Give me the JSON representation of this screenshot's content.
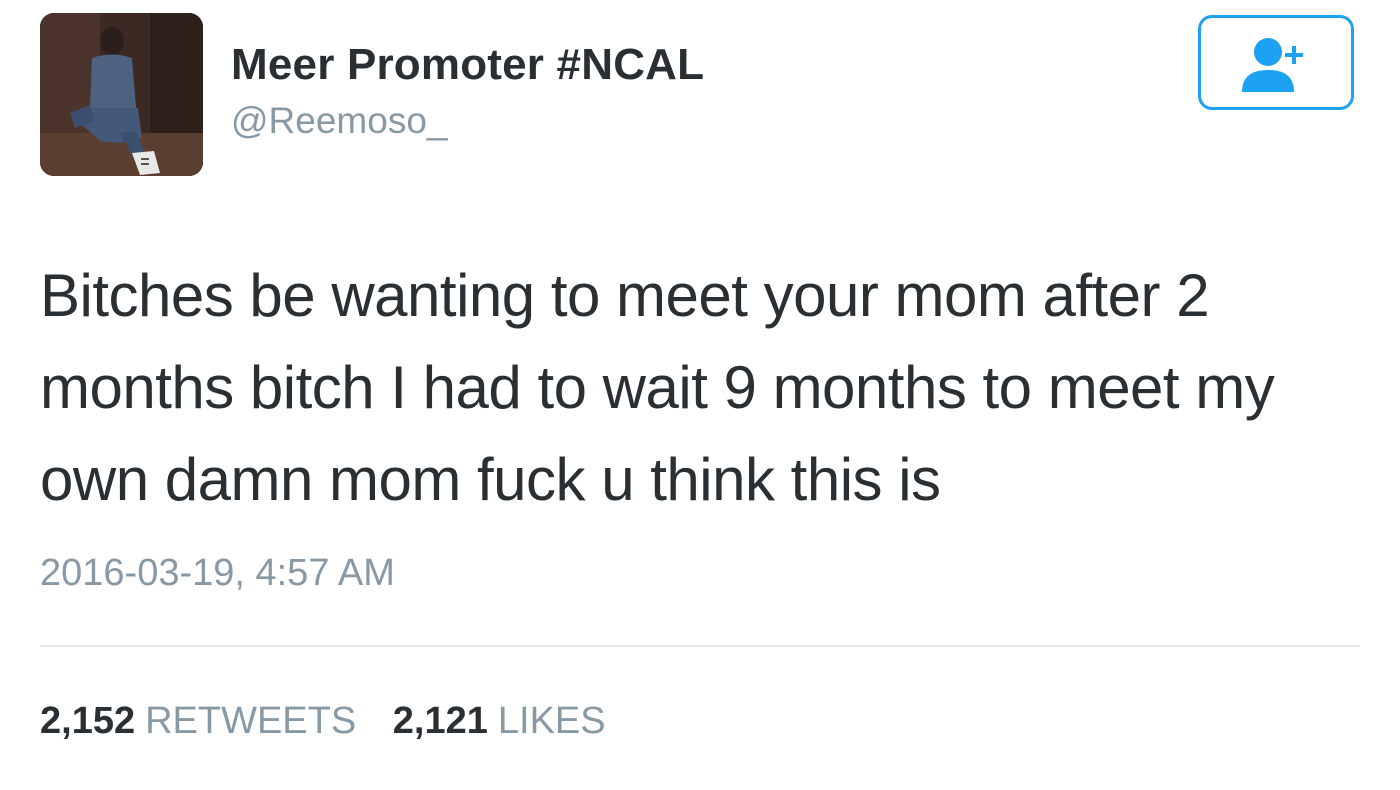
{
  "user": {
    "display_name": "Meer Promoter #NCAL",
    "handle": "@Reemoso_"
  },
  "follow_button": {
    "icon": "add-user-icon",
    "color": "#1da1f2"
  },
  "tweet": {
    "text": "Bitches be wanting to meet your mom after 2 months bitch I had to wait 9 months to meet my own damn mom fuck u think this is",
    "timestamp": "2016-03-19, 4:57 AM"
  },
  "stats": {
    "retweets_count": "2,152",
    "retweets_label": "RETWEETS",
    "likes_count": "2,121",
    "likes_label": "LIKES"
  },
  "colors": {
    "text": "#292f33",
    "muted": "#8899a6",
    "accent": "#1da1f2",
    "divider": "#e1e8ed"
  }
}
